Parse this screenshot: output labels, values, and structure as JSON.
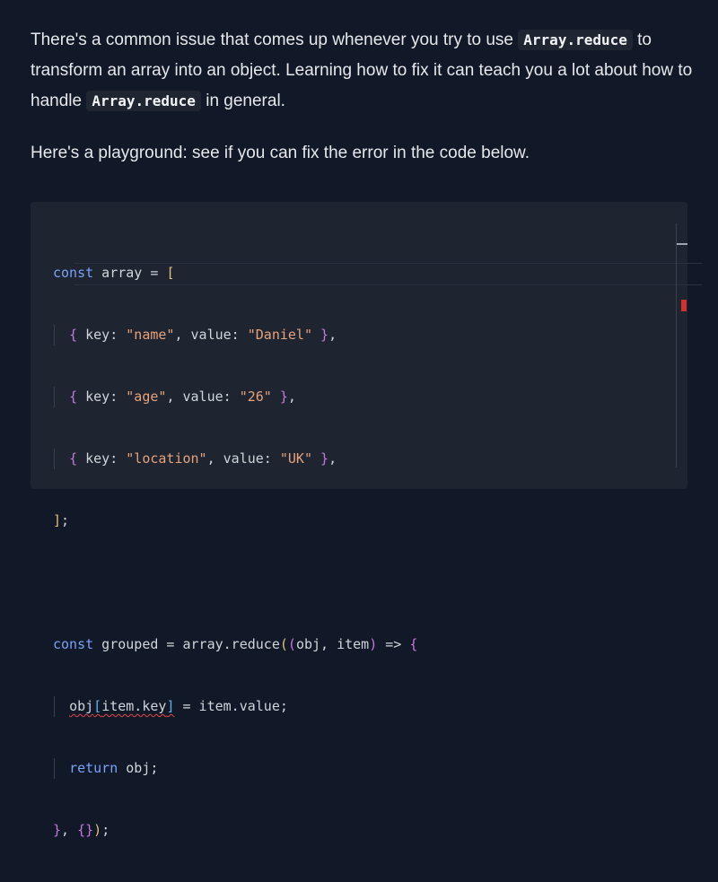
{
  "paragraph1": {
    "part1": "There's a common issue that comes up whenever you try to use ",
    "code1": "Array.reduce",
    "part2": " to transform an array into an object. Learning how to fix it can teach you a lot about how to handle ",
    "code2": "Array.reduce",
    "part3": " in general."
  },
  "paragraph2": "Here's a playground: see if you can fix the error in the code below.",
  "editor": {
    "code": {
      "l1_kw": "const",
      "l1_rest": " array = ",
      "l1_open": "[",
      "l2_open": "{",
      "l2_k1": " key: ",
      "l2_s1": "\"name\"",
      "l2_k2": ", value: ",
      "l2_s2": "\"Daniel\"",
      "l2_close": "}",
      "l3_open": "{",
      "l3_k1": " key: ",
      "l3_s1": "\"age\"",
      "l3_k2": ", value: ",
      "l3_s2": "\"26\"",
      "l3_close": "}",
      "l4_open": "{",
      "l4_k1": " key: ",
      "l4_s1": "\"location\"",
      "l4_k2": ", value: ",
      "l4_s2": "\"UK\"",
      "l4_close": "}",
      "l5_close": "]",
      "l7_kw": "const",
      "l7_rest": " grouped = array.reduce",
      "l7_p1": "(",
      "l7_p2": "(",
      "l7_params": "obj, item",
      "l7_p3": ")",
      "l7_arrow": " => ",
      "l7_brace": "{",
      "l8_obj": "obj",
      "l8_open": "[",
      "l8_key": "item.key",
      "l8_close": "]",
      "l8_rest": " = item.value;",
      "l9_kw": "return",
      "l9_rest": " obj;",
      "l10_brace": "}",
      "l10_comma": ", ",
      "l10_obj": "{}",
      "l10_paren": ")",
      "l10_semi": ";"
    }
  },
  "colors": {
    "background": "#111827",
    "editor_background": "#1e2430",
    "keyword": "#7aa2f7",
    "string": "#e6a37c",
    "error": "#d32f2f"
  }
}
